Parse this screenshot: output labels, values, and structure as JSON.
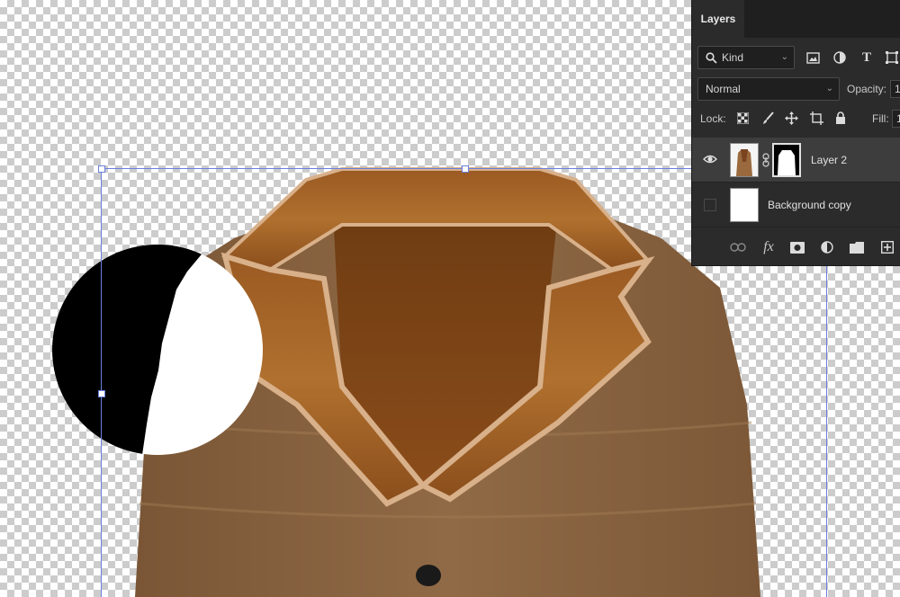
{
  "layers_panel": {
    "tab_label": "Layers",
    "filter": {
      "kind_label": "Kind",
      "icons": [
        "search-icon",
        "image-filter-icon",
        "adjustment-filter-icon",
        "type-filter-icon",
        "shape-filter-icon"
      ]
    },
    "blend_mode": "Normal",
    "opacity_label": "Opacity:",
    "opacity_value": "1",
    "lock_label": "Lock:",
    "lock_icons": [
      "lock-transparency-icon",
      "lock-image-icon",
      "lock-position-icon",
      "lock-artboard-icon",
      "lock-all-icon"
    ],
    "fill_label": "Fill:",
    "fill_value": "1",
    "layers": [
      {
        "name": "Layer 2",
        "visible": true,
        "selected": true,
        "has_mask": true
      },
      {
        "name": "Background copy",
        "visible": false,
        "selected": false,
        "has_mask": false
      }
    ],
    "footer_icons": [
      "link-layers-icon",
      "fx-icon",
      "add-mask-icon",
      "adjustment-layer-icon",
      "group-folder-icon",
      "new-layer-icon"
    ],
    "fx_label": "fx"
  },
  "colors": {
    "panel_bg": "#2b2b2b",
    "tab_bar_bg": "#1f1f1f",
    "selected_row": "#3d3d3d",
    "transform_box": "#6b7fe0",
    "coat_fur": "#8b6440",
    "coat_leather": "#a8682c"
  }
}
